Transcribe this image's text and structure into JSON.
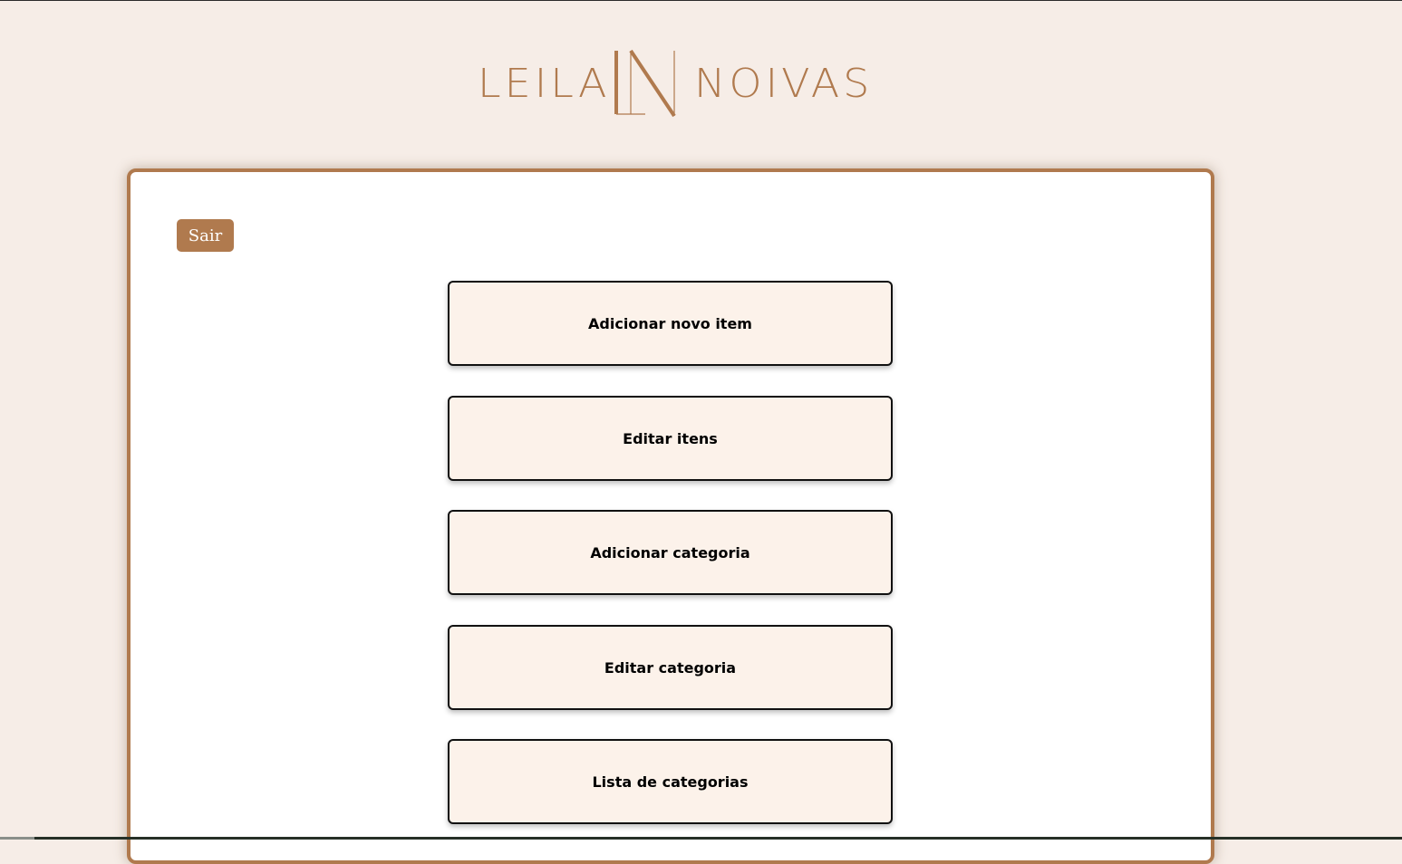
{
  "brand": {
    "logo_left": "LEILA",
    "logo_right": "NOIVAS",
    "logo_monogram": "LN",
    "color": "#b07a4e"
  },
  "header": {
    "logout_label": "Sair"
  },
  "menu": {
    "items": [
      {
        "label": "Adicionar novo item"
      },
      {
        "label": "Editar itens"
      },
      {
        "label": "Adicionar categoria"
      },
      {
        "label": "Editar categoria"
      },
      {
        "label": "Lista de categorias"
      }
    ]
  },
  "colors": {
    "page_background": "#f6ede7",
    "card_background": "#ffffff",
    "button_background": "#fcf2ea",
    "accent": "#b07a4e"
  }
}
